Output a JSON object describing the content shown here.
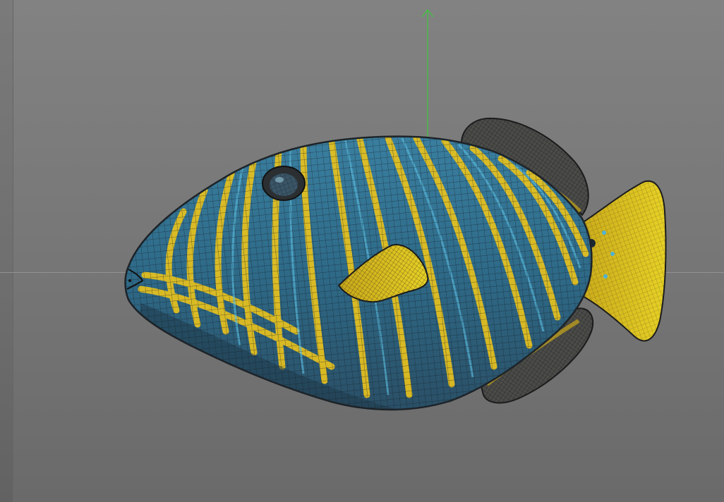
{
  "viewport": {
    "background_top": "#828282",
    "background_bottom": "#6a6a6a",
    "axis_y_color": "#3cc83c",
    "horizon_color": "#9a9a9a"
  },
  "model": {
    "name_icon": "triggerfish-mesh-icon",
    "stripe_yellow": "#e8c21e",
    "body_blue": "#2f6d8c",
    "wire_color": "#1a1f26",
    "fin_yellow": "#d9c21a"
  }
}
